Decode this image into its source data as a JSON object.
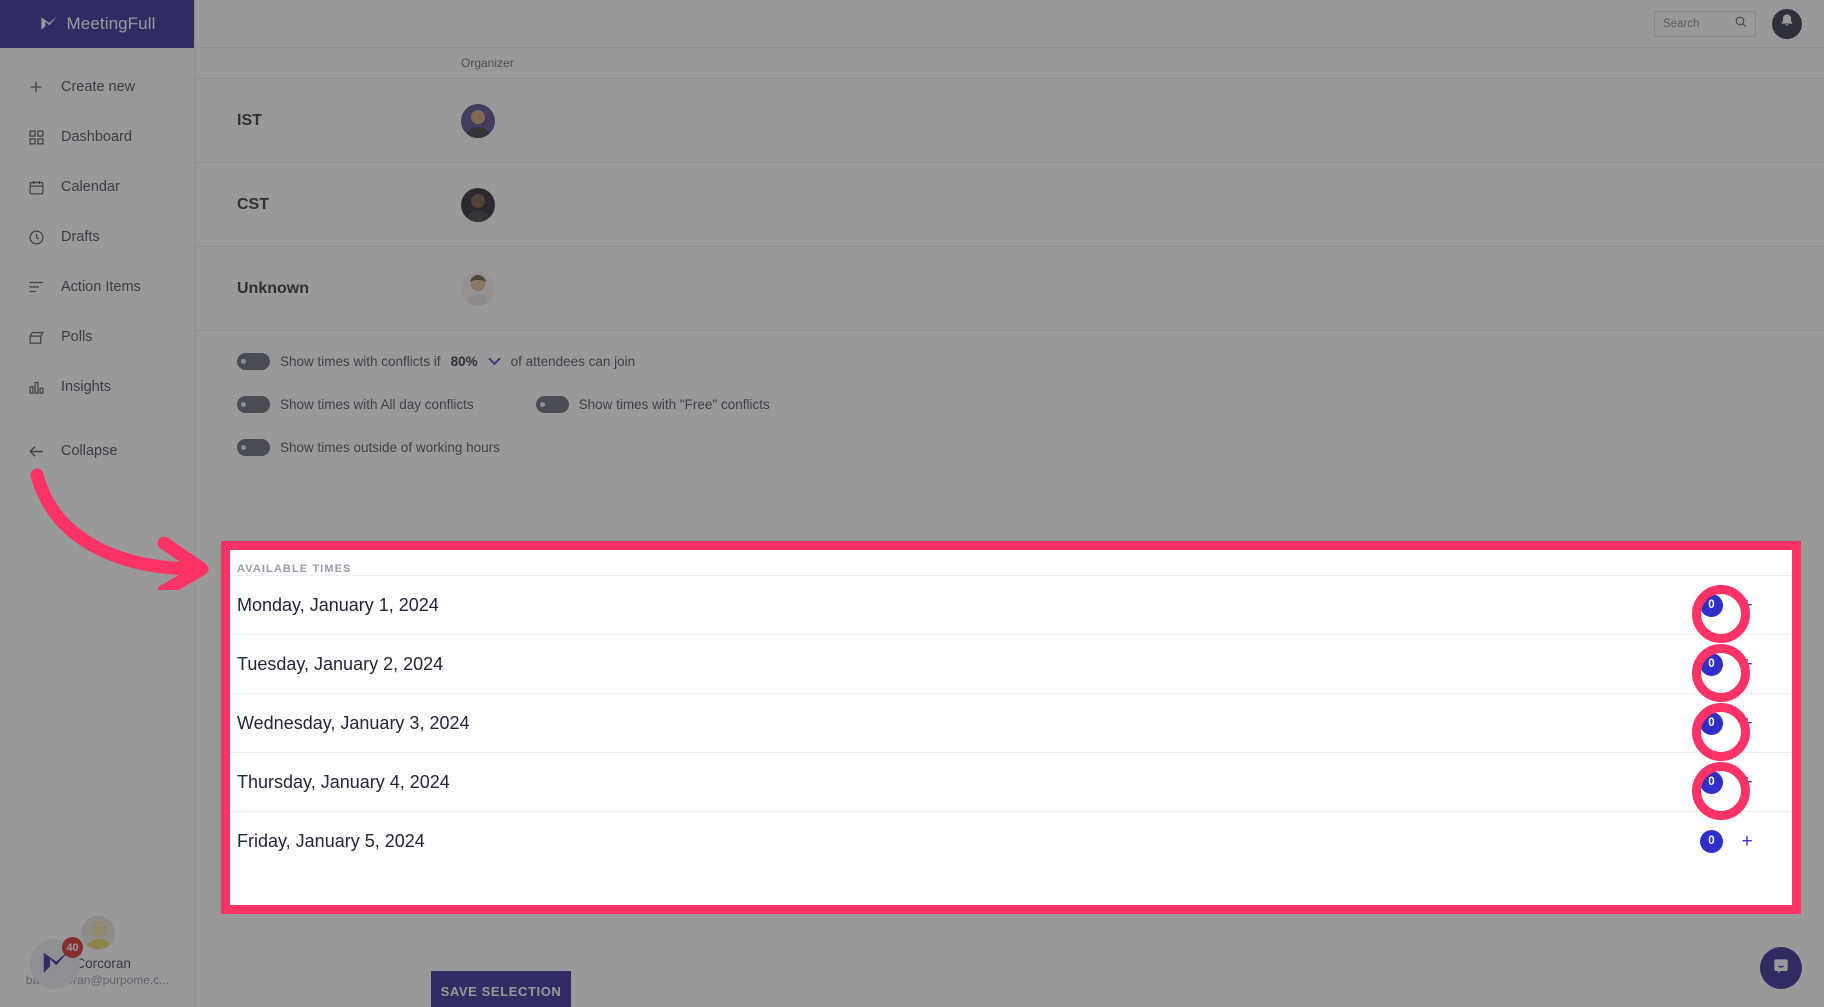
{
  "brand": {
    "name": "MeetingFull",
    "logo_icon": "meetingfull-logo-icon",
    "color": "#241b8f"
  },
  "topbar": {
    "search": {
      "placeholder": "Search",
      "value": "",
      "icon": "search-icon"
    },
    "notifications_icon": "bell-icon"
  },
  "sidebar": {
    "items": [
      {
        "label": "Create new",
        "icon": "plus-icon"
      },
      {
        "label": "Dashboard",
        "icon": "grid-icon"
      },
      {
        "label": "Calendar",
        "icon": "calendar-icon"
      },
      {
        "label": "Drafts",
        "icon": "clock-icon"
      },
      {
        "label": "Action Items",
        "icon": "list-icon"
      },
      {
        "label": "Polls",
        "icon": "poll-icon"
      },
      {
        "label": "Insights",
        "icon": "bar-chart-icon"
      },
      {
        "label": "Collapse",
        "icon": "arrow-left-icon"
      }
    ],
    "user": {
      "name": "a Corcoran",
      "email": "barba...oran@purpome.c...",
      "avatar_icon": "avatar"
    },
    "app_badge": {
      "count": "40",
      "icon": "meetingfull-logo-icon"
    }
  },
  "timezones": {
    "organizer_label": "Organizer",
    "rows": [
      {
        "name": "IST",
        "avatar_icon": "avatar"
      },
      {
        "name": "CST",
        "avatar_icon": "avatar"
      },
      {
        "name": "Unknown",
        "avatar_icon": "avatar"
      }
    ]
  },
  "options": {
    "conflicts": {
      "prefix": "Show times with conflicts if",
      "percent": "80%",
      "caret_icon": "chevron-down-icon",
      "suffix": "of attendees can join",
      "enabled": false
    },
    "all_day": {
      "label": "Show times with All day conflicts",
      "enabled": false
    },
    "free": {
      "label": "Show times with \"Free\" conflicts",
      "enabled": false
    },
    "outside_hours": {
      "label": "Show times outside of working hours",
      "enabled": false
    }
  },
  "available_times": {
    "section_title": "AVAILABLE TIMES",
    "rows": [
      {
        "date": "Monday, January 1, 2024",
        "count": "0",
        "add_label": "+",
        "highlighted": true
      },
      {
        "date": "Tuesday, January 2, 2024",
        "count": "0",
        "add_label": "+",
        "highlighted": true
      },
      {
        "date": "Wednesday, January 3, 2024",
        "count": "0",
        "add_label": "+",
        "highlighted": true
      },
      {
        "date": "Thursday, January 4, 2024",
        "count": "0",
        "add_label": "+",
        "highlighted": true
      },
      {
        "date": "Friday, January 5, 2024",
        "count": "0",
        "add_label": "+",
        "highlighted": false
      }
    ]
  },
  "save_button": {
    "label": "SAVE SELECTION"
  },
  "chat": {
    "icon": "chat-icon"
  },
  "annotation": {
    "color": "#ff3366",
    "arrow_icon": "curved-arrow-icon"
  }
}
